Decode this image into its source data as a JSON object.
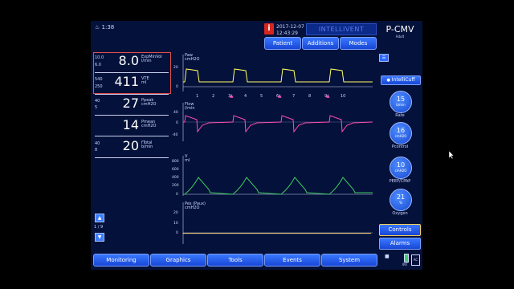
{
  "header": {
    "clock": "1:38",
    "date": "2017-12-07",
    "time": "12:43:29",
    "intellivent_label": "INTELLIVENT",
    "tabs": [
      "Patient",
      "Additions",
      "Modes"
    ],
    "mode": "P-CMV",
    "patient_group": "Adult"
  },
  "monitoring": {
    "primary": [
      {
        "upper": "10.0",
        "lower": "6.0",
        "value": "8.0",
        "label": "ExpMinVol",
        "unit": "l/min"
      },
      {
        "upper": "540",
        "lower": "250",
        "value": "411",
        "label": "VTE",
        "unit": "ml"
      }
    ],
    "secondary": [
      {
        "upper": "40",
        "lower": "5",
        "value": "27",
        "label": "Ppeak",
        "unit": "cmH2O"
      },
      {
        "upper": "",
        "lower": "",
        "value": "14",
        "label": "Pmean",
        "unit": "cmH2O"
      },
      {
        "upper": "40",
        "lower": "8",
        "value": "20",
        "label": "fTotal",
        "unit": "b/min"
      }
    ],
    "page_indicator": "1 / 9"
  },
  "graphs": [
    {
      "label": "Paw",
      "unit": "cmH2O",
      "ticks": [
        "20",
        "0"
      ]
    },
    {
      "label": "Flow",
      "unit": "l/min",
      "ticks": [
        "40",
        "0",
        "-40"
      ]
    },
    {
      "label": "V",
      "unit": "ml",
      "ticks": [
        "800",
        "600",
        "400",
        "200",
        "0"
      ]
    },
    {
      "label": "Pes (Paux)",
      "unit": "cmH2O",
      "ticks": [
        "20",
        "10",
        "0"
      ]
    }
  ],
  "breath_markers": [
    "1",
    "2",
    "3",
    "4",
    "5",
    "6",
    "7",
    "8",
    "9",
    "10"
  ],
  "controls": {
    "intellicuff_label": "IntelliCuff",
    "settings": [
      {
        "value": "15",
        "unit": "b/min",
        "label": "Rate"
      },
      {
        "value": "16",
        "unit": "cmH2O",
        "label": "Pcontrol"
      },
      {
        "value": "10",
        "unit": "cmH2O",
        "label": "PEEP/CPAP"
      },
      {
        "value": "21",
        "unit": "%",
        "label": "Oxygen"
      }
    ],
    "controls_button": "Controls",
    "alarms_button": "Alarms",
    "power_label": "INT"
  },
  "bottom_tabs": [
    "Monitoring",
    "Graphics",
    "Tools",
    "Events",
    "System"
  ],
  "colors": {
    "paw": "#ffff66",
    "flow": "#ff4fb0",
    "volume": "#3ecf5e",
    "pes": "#ffd27a",
    "accent": "#2f6bff",
    "alarm": "#e05050"
  }
}
